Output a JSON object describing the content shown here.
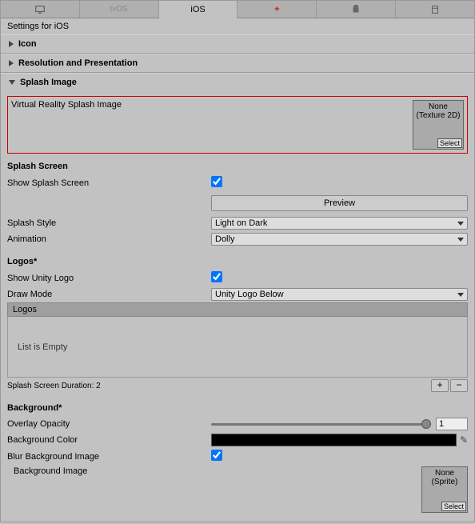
{
  "tabs": {
    "ios_label": "iOS",
    "tvos_label": "tvOS"
  },
  "header": "Settings for iOS",
  "sections": {
    "icon": "Icon",
    "resolution": "Resolution and Presentation",
    "splash": "Splash Image"
  },
  "vr_splash": {
    "label": "Virtual Reality Splash Image",
    "none": "None",
    "type": "(Texture 2D)",
    "select": "Select"
  },
  "splash_screen": {
    "title": "Splash Screen",
    "show_label": "Show Splash Screen",
    "show_value": true,
    "preview": "Preview",
    "style_label": "Splash Style",
    "style_value": "Light on Dark",
    "anim_label": "Animation",
    "anim_value": "Dolly"
  },
  "logos": {
    "title": "Logos*",
    "show_label": "Show Unity Logo",
    "show_value": true,
    "draw_label": "Draw Mode",
    "draw_value": "Unity Logo Below",
    "list_title": "Logos",
    "empty": "List is Empty",
    "duration": "Splash Screen Duration: 2"
  },
  "background": {
    "title": "Background*",
    "opacity_label": "Overlay Opacity",
    "opacity_value": "1",
    "color_label": "Background Color",
    "blur_label": "Blur Background Image",
    "blur_value": true,
    "image_label": "Background Image",
    "none": "None",
    "type": "(Sprite)",
    "select": "Select"
  }
}
